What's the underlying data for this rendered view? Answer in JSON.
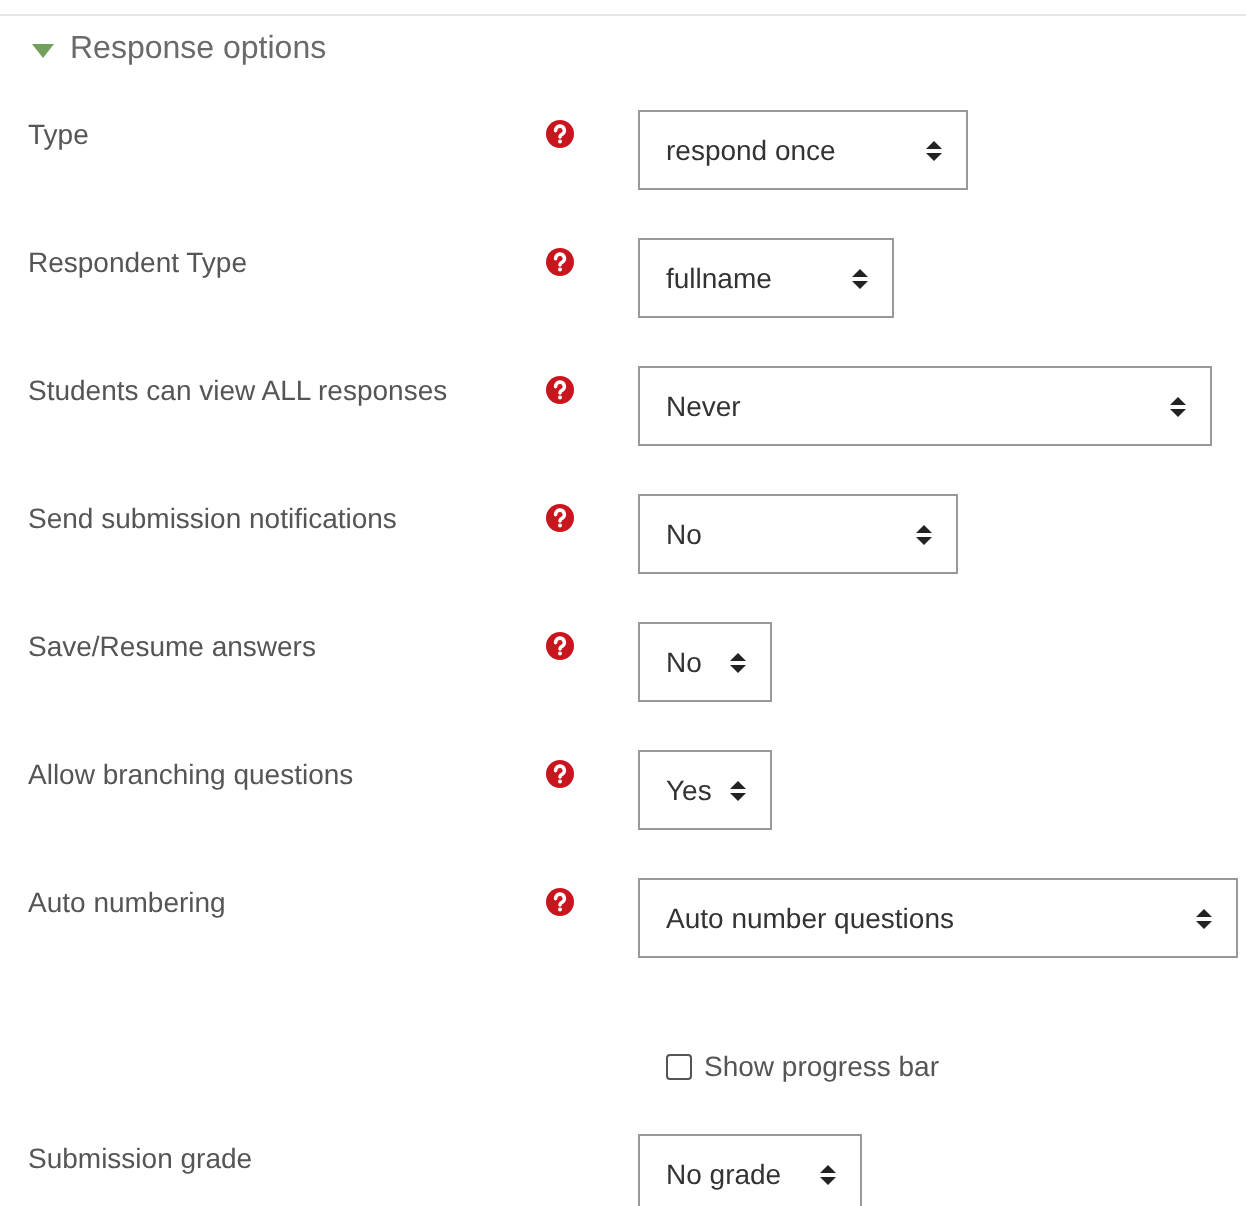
{
  "section": {
    "title": "Response options",
    "expanded": true
  },
  "rows": [
    {
      "kind": "select",
      "label": "Type",
      "help": true,
      "value": "respond once"
    },
    {
      "kind": "select",
      "label": "Respondent Type",
      "help": true,
      "value": "fullname"
    },
    {
      "kind": "select",
      "label": "Students can view ALL responses",
      "help": true,
      "value": "Never"
    },
    {
      "kind": "select",
      "label": "Send submission notifications",
      "help": true,
      "value": "No"
    },
    {
      "kind": "select",
      "label": "Save/Resume answers",
      "help": true,
      "value": "No"
    },
    {
      "kind": "select",
      "label": "Allow branching questions",
      "help": true,
      "value": "Yes"
    },
    {
      "kind": "select",
      "label": "Auto numbering",
      "help": true,
      "value": "Auto number questions"
    },
    {
      "kind": "checkbox",
      "label": "Show progress bar",
      "checked": false
    },
    {
      "kind": "select",
      "label": "Submission grade",
      "help": false,
      "value": "No grade"
    }
  ]
}
